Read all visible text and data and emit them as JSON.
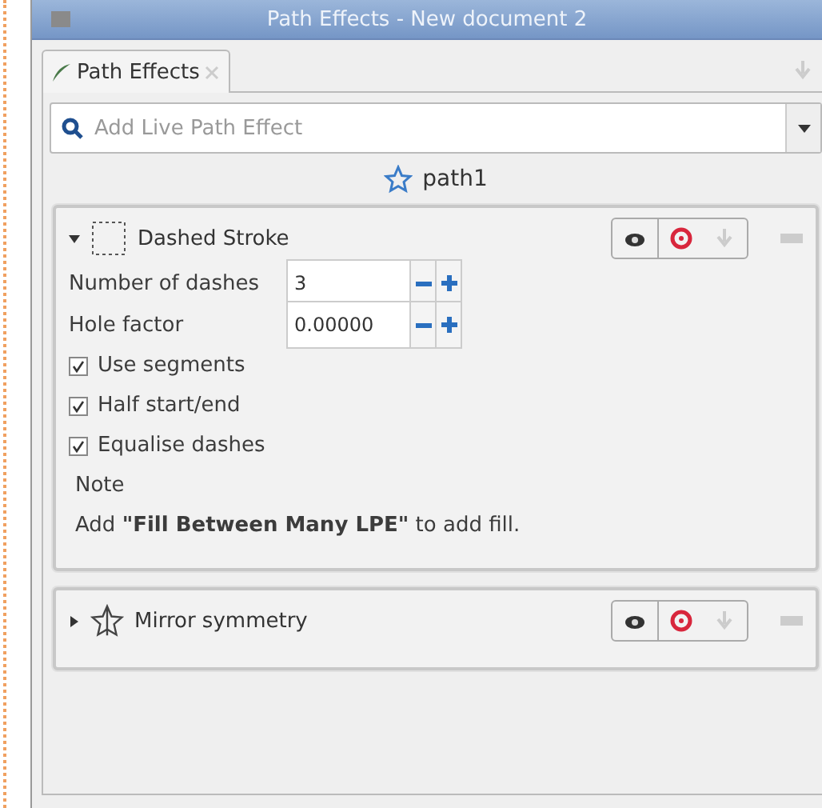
{
  "window": {
    "title": "Path Effects - New document 2"
  },
  "tabs": [
    {
      "label": "Path Effects",
      "selected": true
    }
  ],
  "search": {
    "placeholder": "Add Live Path Effect"
  },
  "object": {
    "name": "path1"
  },
  "effects": [
    {
      "name": "Dashed Stroke",
      "expanded": true,
      "params": [
        {
          "kind": "number",
          "label": "Number of dashes",
          "value": "3"
        },
        {
          "kind": "number",
          "label": "Hole factor",
          "value": "0.00000"
        },
        {
          "kind": "checkbox",
          "label": "Use segments",
          "checked": true
        },
        {
          "kind": "checkbox",
          "label": "Half start/end",
          "checked": true
        },
        {
          "kind": "checkbox",
          "label": "Equalise dashes",
          "checked": true
        },
        {
          "kind": "text",
          "text": "Note"
        },
        {
          "kind": "text",
          "text": "Add **\"Fill Between Many LPE\"** to add fill."
        }
      ]
    },
    {
      "name": "Mirror symmetry",
      "expanded": false
    }
  ]
}
